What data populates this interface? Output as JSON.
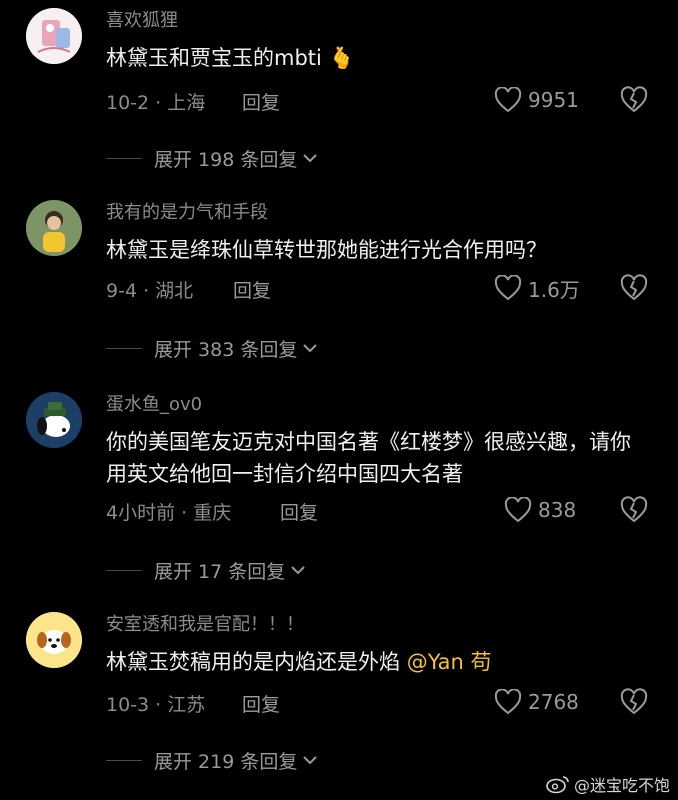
{
  "comments": [
    {
      "username": "喜欢狐狸",
      "text": "林黛玉和贾宝玉的mbti",
      "emoji": "🫰",
      "mention": "",
      "meta": "10-2 · 上海",
      "reply_label": "回复",
      "likes": "9951",
      "expand": "展开 198 条回复"
    },
    {
      "username": "我有的是力气和手段",
      "text": "林黛玉是绛珠仙草转世那她能进行光合作用吗？",
      "emoji": "",
      "mention": "",
      "meta": "9-4 · 湖北",
      "reply_label": "回复",
      "likes": "1.6万",
      "expand": "展开 383 条回复"
    },
    {
      "username": "蛋水鱼_ov0",
      "text": "你的美国笔友迈克对中国名著《红楼梦》很感兴趣，请你用英文给他回一封信介绍中国四大名著",
      "emoji": "",
      "mention": "",
      "meta": "4小时前 · 重庆",
      "reply_label": "回复",
      "likes": "838",
      "expand": "展开 17 条回复"
    },
    {
      "username": "安室透和我是官配！！！",
      "text": "林黛玉焚稿用的是内焰还是外焰 ",
      "emoji": "",
      "mention": "@Yan 苟",
      "meta": "10-3 · 江苏",
      "reply_label": "回复",
      "likes": "2768",
      "expand": "展开 219 条回复"
    }
  ],
  "watermark": "@迷宝吃不饱",
  "colors": {
    "background": "#000000",
    "secondary_text": "#8b8b8b",
    "mention": "#f2c230"
  }
}
